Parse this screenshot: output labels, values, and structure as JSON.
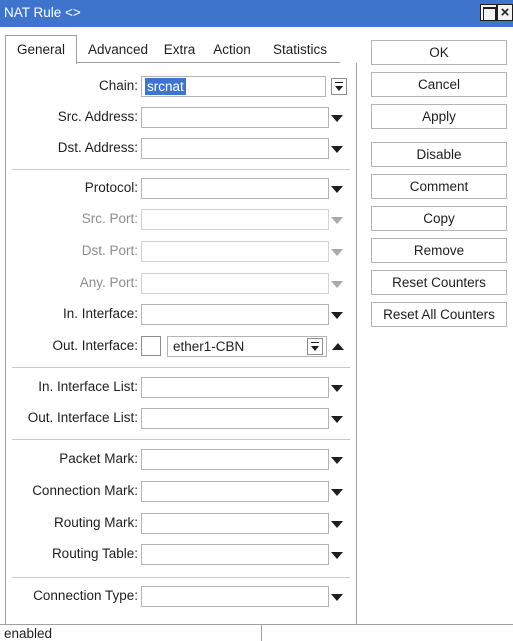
{
  "window": {
    "title": "NAT Rule <>"
  },
  "tabs": [
    {
      "label": "General",
      "active": true
    },
    {
      "label": "Advanced",
      "active": false
    },
    {
      "label": "Extra",
      "active": false
    },
    {
      "label": "Action",
      "active": false
    },
    {
      "label": "Statistics",
      "active": false
    }
  ],
  "fields": {
    "chain": {
      "label": "Chain:",
      "value": "srcnat"
    },
    "src_address": {
      "label": "Src. Address:",
      "value": ""
    },
    "dst_address": {
      "label": "Dst. Address:",
      "value": ""
    },
    "protocol": {
      "label": "Protocol:",
      "value": ""
    },
    "src_port": {
      "label": "Src. Port:",
      "value": "",
      "disabled": true
    },
    "dst_port": {
      "label": "Dst. Port:",
      "value": "",
      "disabled": true
    },
    "any_port": {
      "label": "Any. Port:",
      "value": "",
      "disabled": true
    },
    "in_interface": {
      "label": "In. Interface:",
      "value": ""
    },
    "out_interface": {
      "label": "Out. Interface:",
      "value": "ether1-CBN",
      "negate_checked": false
    },
    "in_interface_list": {
      "label": "In. Interface List:",
      "value": ""
    },
    "out_interface_list": {
      "label": "Out. Interface List:",
      "value": ""
    },
    "packet_mark": {
      "label": "Packet Mark:",
      "value": ""
    },
    "connection_mark": {
      "label": "Connection Mark:",
      "value": ""
    },
    "routing_mark": {
      "label": "Routing Mark:",
      "value": ""
    },
    "routing_table": {
      "label": "Routing Table:",
      "value": ""
    },
    "connection_type": {
      "label": "Connection Type:",
      "value": ""
    }
  },
  "buttons": {
    "ok": "OK",
    "cancel": "Cancel",
    "apply": "Apply",
    "disable": "Disable",
    "comment": "Comment",
    "copy": "Copy",
    "remove": "Remove",
    "reset_counters": "Reset Counters",
    "reset_all_counters": "Reset All Counters"
  },
  "status": {
    "text": "enabled"
  },
  "colors": {
    "titlebar": "#3e74cc",
    "selection": "#3e74cc"
  }
}
